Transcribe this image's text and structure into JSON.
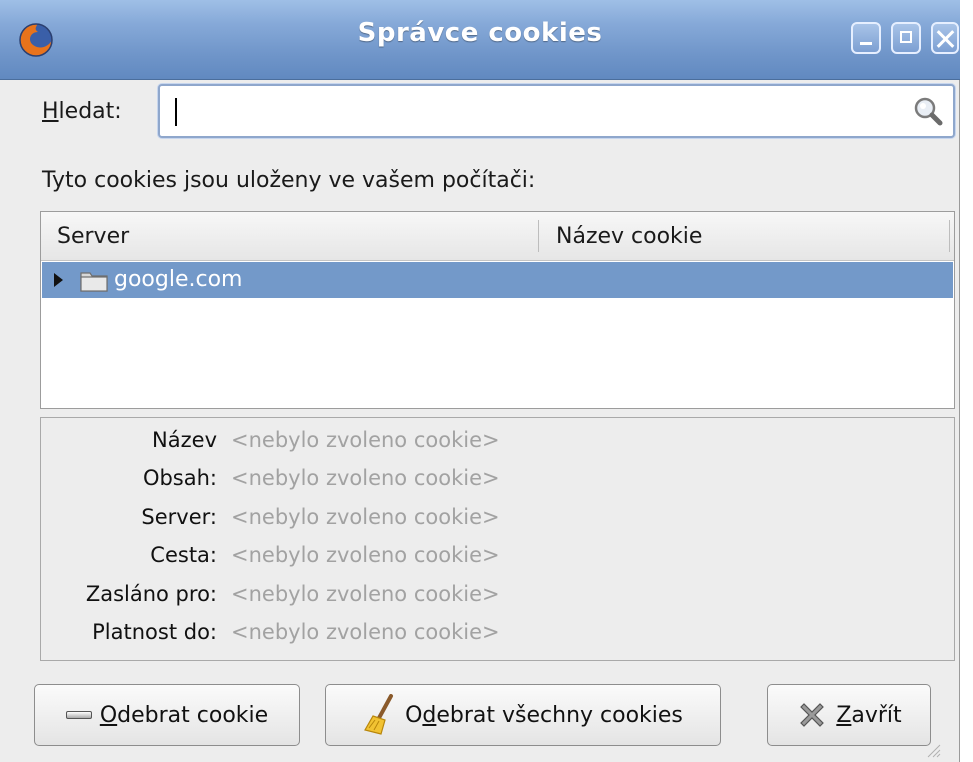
{
  "window": {
    "title": "Správce cookies",
    "accent": "#7399c9",
    "icons": {
      "app": "firefox-icon",
      "minimize": "minimize-icon",
      "maximize": "maximize-icon",
      "close": "close-icon"
    }
  },
  "search": {
    "label_mnemonic": "H",
    "label_rest": "ledat:",
    "value": "",
    "placeholder": "",
    "icon": "magnifier-icon"
  },
  "info_text": "Tyto cookies jsou uloženy ve vašem počítači:",
  "tree": {
    "columns": [
      "Server",
      "Název cookie"
    ],
    "rows": [
      {
        "label": "google.com",
        "selected": true,
        "expanded": false,
        "icon": "folder-icon"
      }
    ]
  },
  "details": {
    "rows": [
      {
        "label": "Název",
        "value": "<nebylo zvoleno cookie>"
      },
      {
        "label": "Obsah:",
        "value": "<nebylo zvoleno cookie>"
      },
      {
        "label": "Server:",
        "value": "<nebylo zvoleno cookie>"
      },
      {
        "label": "Cesta:",
        "value": "<nebylo zvoleno cookie>"
      },
      {
        "label": "Zasláno pro:",
        "value": "<nebylo zvoleno cookie>"
      },
      {
        "label": "Platnost do:",
        "value": "<nebylo zvoleno cookie>"
      }
    ]
  },
  "buttons": {
    "remove": {
      "mnemonic": "O",
      "rest": "debrat cookie",
      "icon": "minus-icon"
    },
    "remove_all": {
      "pre": "O",
      "mnemonic": "d",
      "rest": "ebrat všechny cookies",
      "icon": "broom-icon"
    },
    "close": {
      "mnemonic": "Z",
      "rest": "avřít",
      "icon": "close-x-icon"
    }
  }
}
